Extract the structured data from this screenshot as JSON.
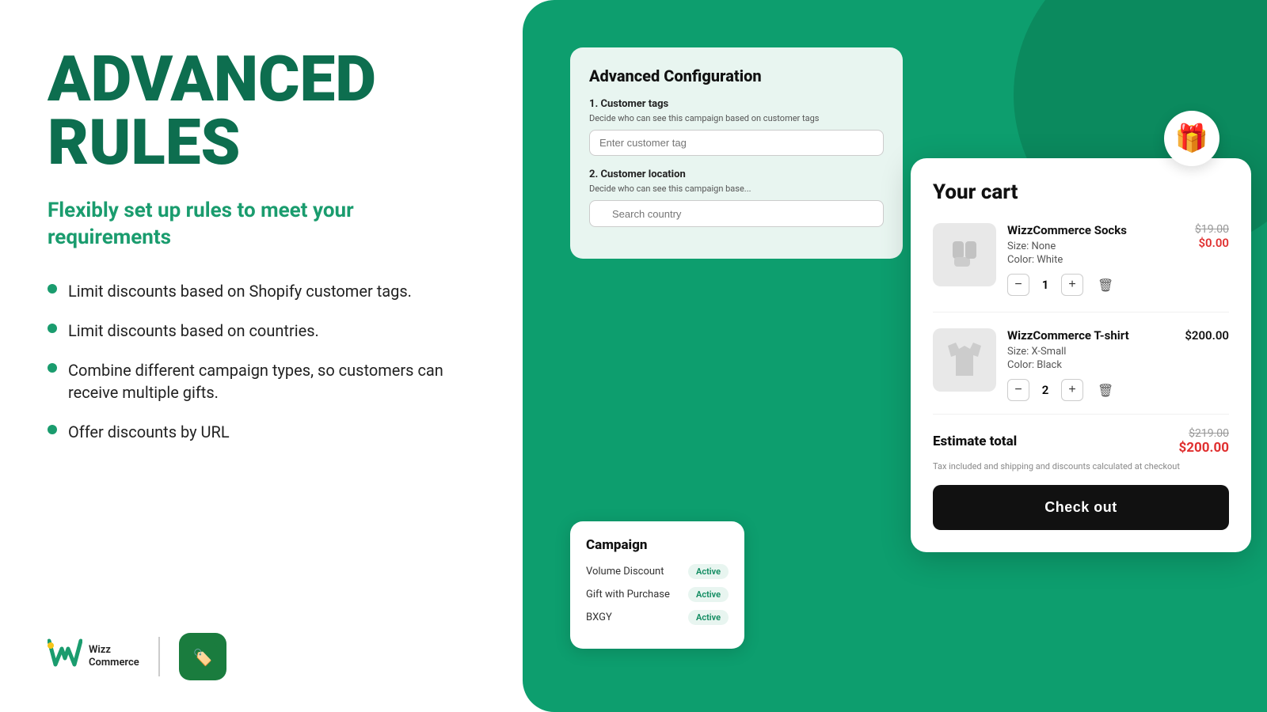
{
  "left": {
    "title_line1": "ADVANCED",
    "title_line2": "RULES",
    "subtitle": "Flexibly set up rules to meet your requirements",
    "bullets": [
      "Limit discounts based on Shopify customer tags.",
      "Limit discounts based on countries.",
      "Combine different campaign types, so customers can receive multiple gifts.",
      "Offer discounts by URL"
    ],
    "logo_w": "W",
    "logo_text_line1": "Wizz",
    "logo_text_line2": "Commerce"
  },
  "adv_config": {
    "title": "Advanced Configuration",
    "section1_title": "1. Customer tags",
    "section1_desc": "Decide who can see this campaign based on customer tags",
    "section1_placeholder": "Enter customer tag",
    "section2_title": "2. Customer location",
    "section2_desc": "Decide who can see this campaign base...",
    "section2_placeholder": "Search country"
  },
  "campaign": {
    "title": "Campaign",
    "items": [
      {
        "name": "Volume Discount",
        "status": "Active"
      },
      {
        "name": "Gift with Purchase",
        "status": "Active"
      },
      {
        "name": "BXGY",
        "status": "Active"
      }
    ]
  },
  "cart": {
    "title": "Your cart",
    "items": [
      {
        "name": "WizzCommerce Socks",
        "attr1": "Size: None",
        "attr2": "Color: White",
        "price_original": "$19.00",
        "price_discounted": "$0.00",
        "qty": "1",
        "type": "socks"
      },
      {
        "name": "WizzCommerce T-shirt",
        "attr1": "Size: X-Small",
        "attr2": "Color: Black",
        "price_full": "$200.00",
        "qty": "2",
        "type": "tshirt"
      }
    ],
    "estimate_label": "Estimate total",
    "estimate_original": "$219.00",
    "estimate_discounted": "$200.00",
    "tax_note": "Tax included and shipping and discounts calculated at checkout",
    "checkout_label": "Check out"
  },
  "gift_icon": "🎁"
}
